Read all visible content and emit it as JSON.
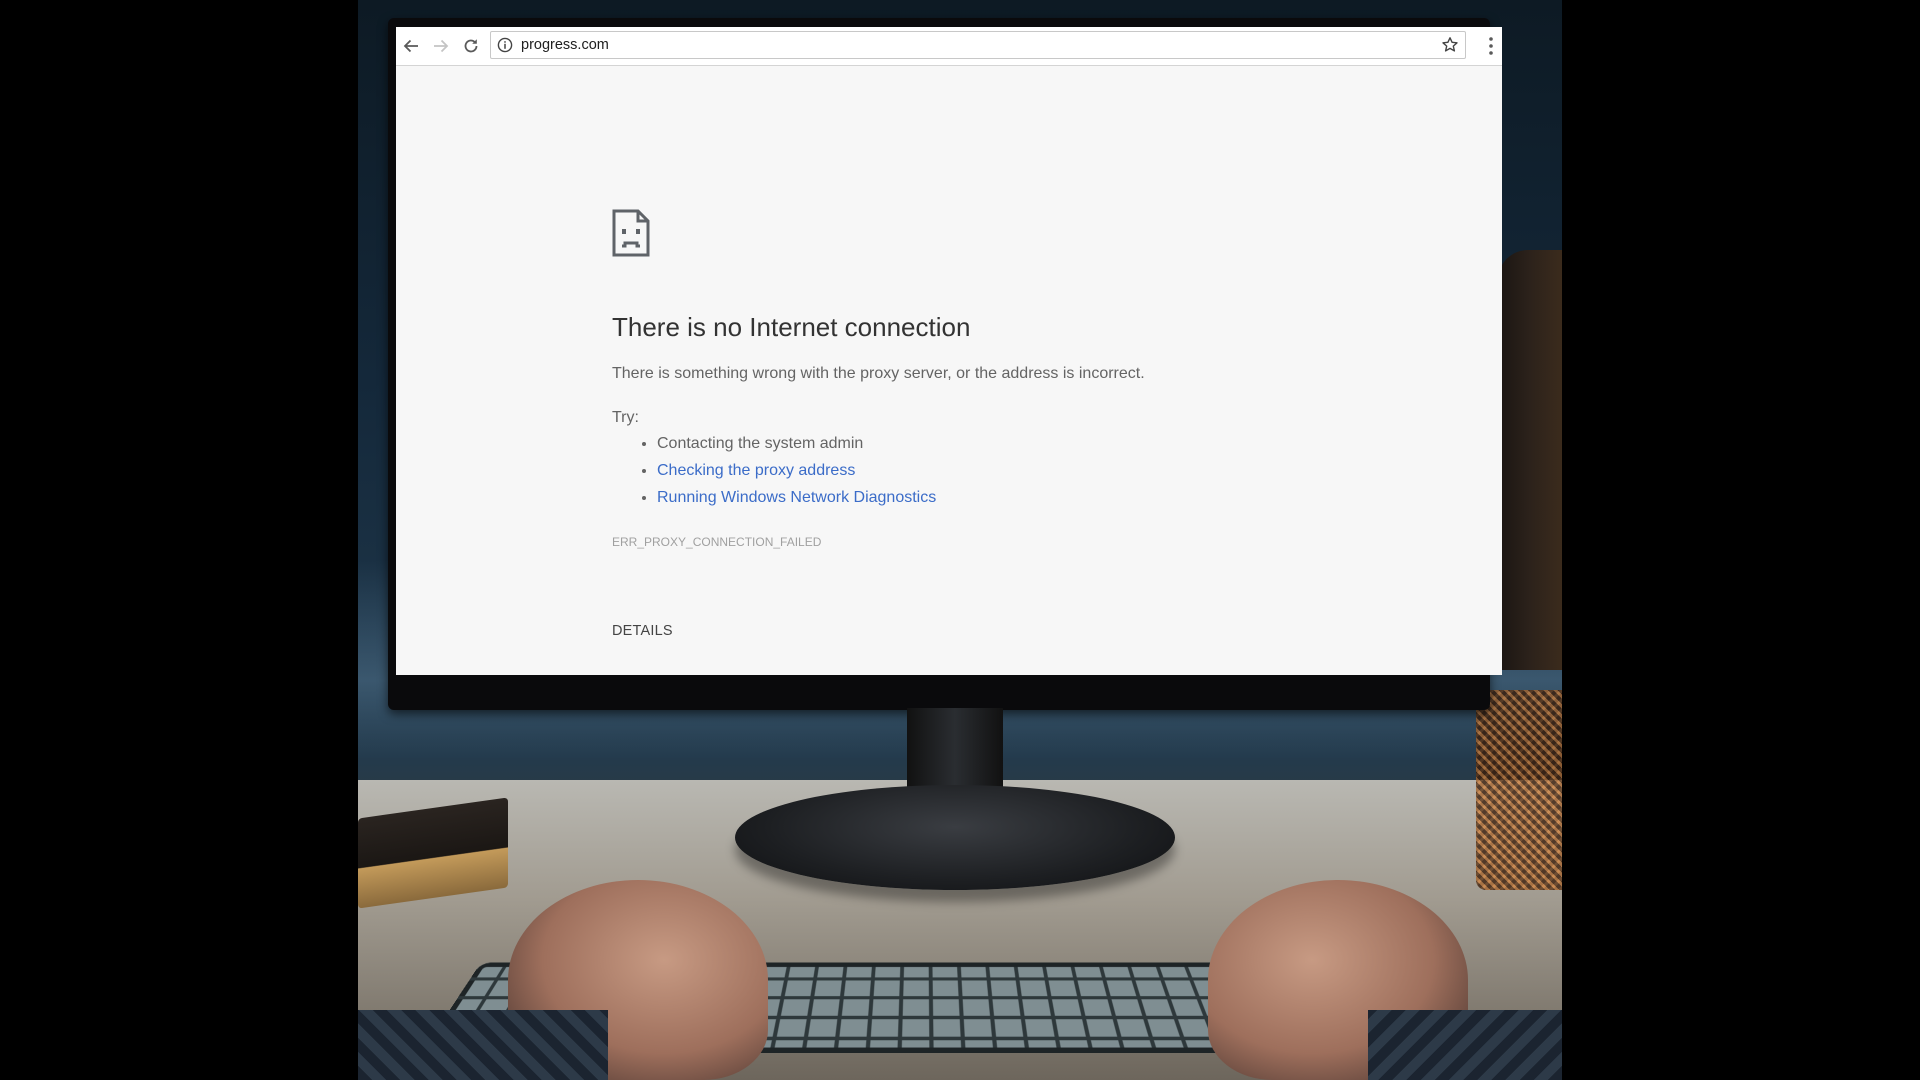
{
  "browser": {
    "url": "progress.com",
    "icons": {
      "back": "arrow-left-icon",
      "forward": "arrow-right-icon",
      "reload": "reload-icon",
      "site_info": "info-icon",
      "bookmark": "star-icon",
      "menu": "vertical-dots-icon"
    }
  },
  "error_page": {
    "icon": "sad-page-icon",
    "title": "There is no Internet connection",
    "description": "There is something wrong with the proxy server, or the address is incorrect.",
    "try_label": "Try:",
    "suggestions": [
      {
        "text": "Contacting the system admin",
        "is_link": false
      },
      {
        "text": "Checking the proxy address",
        "is_link": true
      },
      {
        "text": "Running Windows Network Diagnostics",
        "is_link": true
      }
    ],
    "error_code": "ERR_PROXY_CONNECTION_FAILED",
    "details_label": "DETAILS"
  },
  "colors": {
    "page_background": "#f7f7f7",
    "link": "#3b6cc8",
    "title_text": "#333333",
    "body_text": "#646464",
    "error_code_text": "#a0a0a0"
  }
}
